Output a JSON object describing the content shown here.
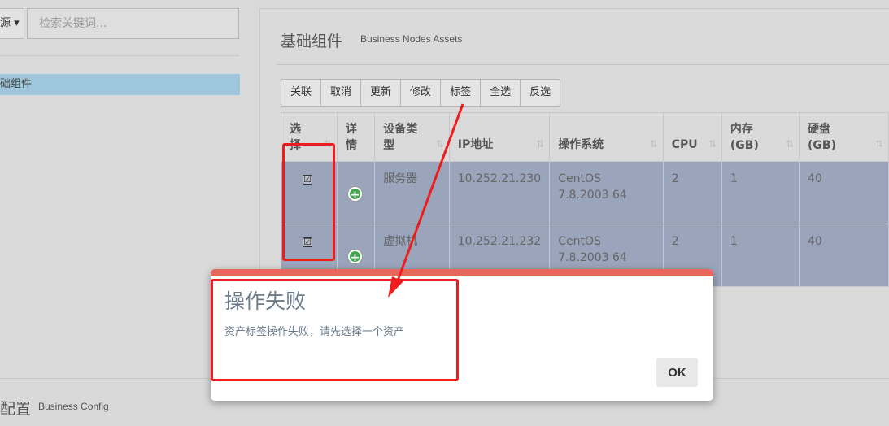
{
  "left": {
    "dropdown_label": "源",
    "search_placeholder": "检索关键词...",
    "tree_item_label": "础组件"
  },
  "bottom": {
    "title": "配置",
    "subtitle": "Business Config"
  },
  "panel": {
    "title": "基础组件",
    "subtitle": "Business Nodes Assets"
  },
  "toolbar": [
    "关联",
    "取消",
    "更新",
    "修改",
    "标签",
    "全选",
    "反选"
  ],
  "table": {
    "headers": [
      "选\n择",
      "详\n情",
      "设备类\n型",
      "IP地址",
      "操作系统",
      "CPU",
      "内存\n(GB)",
      "硬盘\n(GB)"
    ],
    "sort_icon": "⇅",
    "rows": [
      {
        "checked": "☑",
        "type": "服务器",
        "ip": "10.252.21.230",
        "os": "CentOS 7.8.2003 64",
        "cpu": "2",
        "mem": "1",
        "disk": "40"
      },
      {
        "checked": "☑",
        "type": "虚拟机",
        "ip": "10.252.21.232",
        "os": "CentOS 7.8.2003 64",
        "cpu": "2",
        "mem": "1",
        "disk": "40"
      }
    ]
  },
  "dialog": {
    "title": "操作失败",
    "message": "资产标签操作失败，请先选择一个资产",
    "ok_label": "OK",
    "accent_color": "#e8675c"
  },
  "annotation_color": "#ee1c1c"
}
